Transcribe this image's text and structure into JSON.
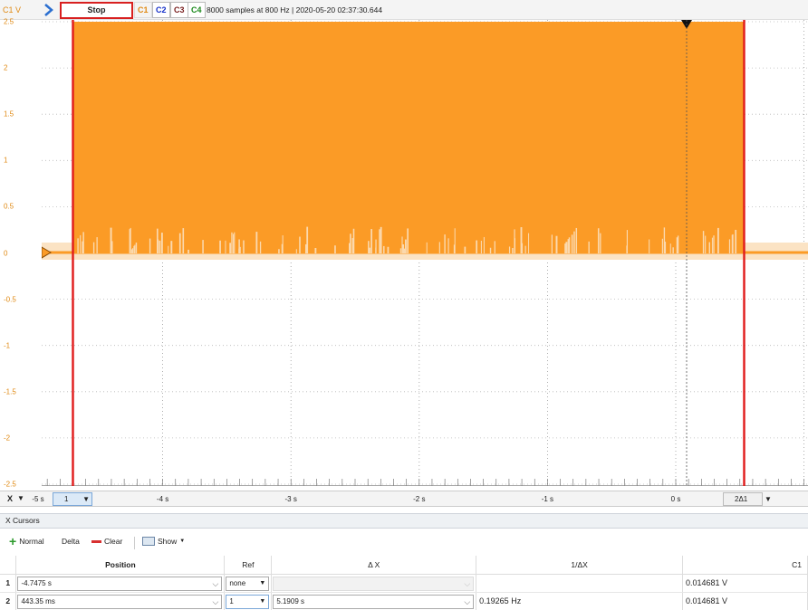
{
  "toolbar": {
    "unit_label": "C1 V",
    "stop_label": "Stop",
    "channels": [
      "C1",
      "C2",
      "C3",
      "C4"
    ],
    "info": "8000 samples at 800 Hz | 2020-05-20 02:37:30.644"
  },
  "colors": {
    "trace": "#fb9b26",
    "trace_light": "#fbd9ae",
    "cursor": "#e01b1b",
    "accent": "#e08a14"
  },
  "y_ticks": [
    "2.5",
    "2",
    "1.5",
    "1",
    "0.5",
    "0",
    "-0.5",
    "-1",
    "-1.5",
    "-2",
    "-2.5"
  ],
  "x_axis": {
    "label": "X",
    "ticks": [
      "-5 s",
      "-4 s",
      "-3 s",
      "-2 s",
      "-1 s",
      "0 s"
    ],
    "cursor_select": "1",
    "delta_select": "2Δ1"
  },
  "cursors_panel": {
    "title": "X Cursors",
    "buttons": {
      "normal": "Normal",
      "delta": "Delta",
      "clear": "Clear",
      "show": "Show"
    },
    "headers": {
      "position": "Position",
      "ref": "Ref",
      "dx": "Δ X",
      "inv_dx": "1/ΔX",
      "c1": "C1"
    },
    "rows": [
      {
        "num": "1",
        "position": "-4.7475 s",
        "ref": "none",
        "dx": "",
        "inv_dx": "",
        "c1": "0.014681 V"
      },
      {
        "num": "2",
        "position": "443.35 ms",
        "ref": "1",
        "dx": "5.1909 s",
        "inv_dx": "0.19265 Hz",
        "c1": "0.014681 V"
      }
    ]
  }
}
